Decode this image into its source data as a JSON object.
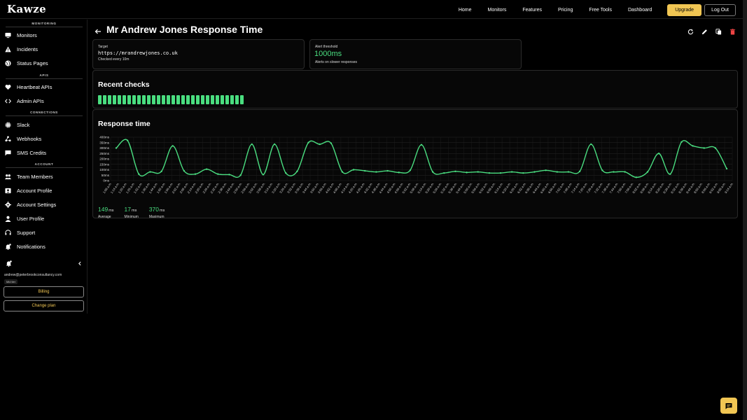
{
  "app": {
    "logo": "Kawze"
  },
  "nav": {
    "items": [
      "Home",
      "Monitors",
      "Features",
      "Pricing",
      "Free Tools",
      "Dashboard"
    ],
    "upgrade": "Upgrade",
    "logout": "Log Out"
  },
  "sidebar": {
    "sections": [
      {
        "title": "MONITORING",
        "items": [
          {
            "label": "Monitors",
            "icon": "monitor-icon"
          },
          {
            "label": "Incidents",
            "icon": "warning-icon"
          },
          {
            "label": "Status Pages",
            "icon": "globe-icon"
          }
        ]
      },
      {
        "title": "APIS",
        "items": [
          {
            "label": "Heartbeat APIs",
            "icon": "heart-icon"
          },
          {
            "label": "Admin APIs",
            "icon": "code-icon"
          }
        ]
      },
      {
        "title": "CONNECTIONS",
        "items": [
          {
            "label": "Slack",
            "icon": "slack-icon"
          },
          {
            "label": "Webhooks",
            "icon": "webhook-icon"
          },
          {
            "label": "SMS Credits",
            "icon": "sms-icon"
          }
        ]
      },
      {
        "title": "ACCOUNT",
        "items": [
          {
            "label": "Team Members",
            "icon": "team-icon"
          },
          {
            "label": "Account Profile",
            "icon": "profile-icon"
          },
          {
            "label": "Account Settings",
            "icon": "gear-icon"
          },
          {
            "label": "User Profile",
            "icon": "user-icon"
          },
          {
            "label": "Support",
            "icon": "support-icon"
          },
          {
            "label": "Notifications",
            "icon": "bell-icon"
          }
        ]
      }
    ],
    "email": "andrew@peterbrookconsultancy.com",
    "tier": "Mid tier",
    "billing": "Billing",
    "change_plan": "Change plan"
  },
  "page": {
    "title": "Mr Andrew Jones Response Time",
    "target_label": "Target",
    "target_url": "https://mrandrewjones.co.uk",
    "checked_every": "Checked every 10m",
    "alert_label": "Alert threshold",
    "alert_value": "1000ms",
    "alert_note": "Alerts on slower responses",
    "recent_checks_title": "Recent checks",
    "recent_checks_count": 30,
    "response_title": "Response time"
  },
  "stats": {
    "average": "149",
    "average_unit": "ms",
    "average_label": "Average",
    "minimum": "17",
    "minimum_unit": "ms",
    "minimum_label": "Minimum",
    "maximum": "370",
    "maximum_unit": "ms",
    "maximum_label": "Maximum"
  },
  "colors": {
    "accent": "#4ade80",
    "brand": "#f1c653",
    "background": "#000000"
  },
  "chart_data": {
    "type": "line",
    "title": "Response time",
    "ylim": [
      0,
      400
    ],
    "y_ticks": [
      "400ms",
      "350ms",
      "300ms",
      "250ms",
      "200ms",
      "150ms",
      "100ms",
      "50ms",
      "0ms"
    ],
    "grid": true,
    "x": [
      "1:08 a.m.",
      "1:14 a.m.",
      "1:20 a.m.",
      "1:26 a.m.",
      "1:32 a.m.",
      "1:38 a.m.",
      "1:44 a.m.",
      "1:50 a.m.",
      "1:56 a.m.",
      "2:02 a.m.",
      "2:08 a.m.",
      "2:14 a.m.",
      "2:20 a.m.",
      "2:26 a.m.",
      "2:32 a.m.",
      "2:38 a.m.",
      "2:44 a.m.",
      "2:50 a.m.",
      "2:56 a.m.",
      "3:02 a.m.",
      "3:08 a.m.",
      "3:14 a.m.",
      "3:20 a.m.",
      "3:26 a.m.",
      "3:32 a.m.",
      "3:38 a.m.",
      "3:44 a.m.",
      "3:50 a.m.",
      "3:56 a.m.",
      "4:02 a.m.",
      "4:08 a.m.",
      "4:14 a.m.",
      "4:20 a.m.",
      "4:26 a.m.",
      "4:32 a.m.",
      "4:38 a.m.",
      "4:44 a.m.",
      "4:50 a.m.",
      "4:56 a.m.",
      "5:02 a.m.",
      "5:08 a.m.",
      "5:14 a.m.",
      "5:20 a.m.",
      "5:26 a.m.",
      "5:32 a.m.",
      "5:38 a.m.",
      "5:44 a.m.",
      "5:50 a.m.",
      "5:56 a.m.",
      "6:02 a.m.",
      "6:08 a.m.",
      "6:14 a.m.",
      "6:20 a.m.",
      "6:26 a.m.",
      "6:32 a.m.",
      "6:38 a.m.",
      "6:44 a.m.",
      "6:50 a.m.",
      "6:56 a.m.",
      "7:02 a.m.",
      "7:08 a.m.",
      "7:14 a.m.",
      "7:20 a.m.",
      "7:26 a.m.",
      "7:32 a.m.",
      "7:38 a.m.",
      "7:44 a.m.",
      "7:50 a.m.",
      "7:56 a.m.",
      "8:02 a.m.",
      "8:08 a.m.",
      "8:14 a.m.",
      "8:20 a.m.",
      "8:26 a.m.",
      "8:32 a.m.",
      "8:38 a.m.",
      "8:44 a.m.",
      "8:50 a.m.",
      "8:56 a.m.",
      "9:02 a.m.",
      "9:08 a.m.",
      "9:14 a.m."
    ],
    "series": [
      {
        "values": [
          300,
          370,
          60,
          80,
          85,
          320,
          90,
          60,
          105,
          60,
          55,
          50,
          335,
          55,
          335,
          70,
          85,
          350,
          335,
          345,
          80,
          100,
          90,
          80,
          90,
          75,
          95,
          330,
          80,
          70,
          85,
          75,
          80,
          70,
          70,
          80,
          70,
          80,
          95,
          80,
          80,
          85,
          335,
          95,
          80,
          80,
          30,
          80,
          250,
          60,
          355,
          320,
          300,
          300,
          110
        ]
      }
    ]
  }
}
